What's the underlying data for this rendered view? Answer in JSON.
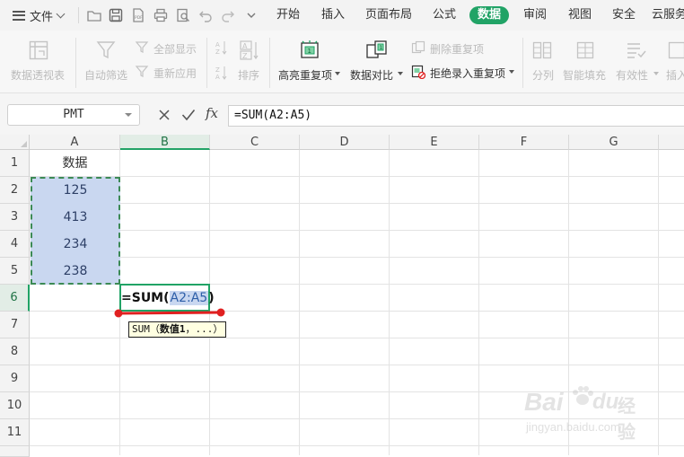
{
  "menu": {
    "file_label": "文件",
    "tabs": [
      {
        "label": "开始",
        "active": false
      },
      {
        "label": "插入",
        "active": false
      },
      {
        "label": "页面布局",
        "active": false
      },
      {
        "label": "公式",
        "active": false
      },
      {
        "label": "数据",
        "active": true
      },
      {
        "label": "审阅",
        "active": false
      },
      {
        "label": "视图",
        "active": false
      },
      {
        "label": "安全",
        "active": false
      },
      {
        "label": "云服务",
        "active": false
      }
    ]
  },
  "ribbon": {
    "pivot": "数据透视表",
    "autofilter": "自动筛选",
    "show_all": "全部显示",
    "reapply": "重新应用",
    "sort": "排序",
    "highlight_dup": "高亮重复项",
    "compare": "数据对比",
    "remove_dup": "删除重复项",
    "reject_dup": "拒绝录入重复项",
    "split": "分列",
    "flash_fill": "智能填充",
    "validity": "有效性",
    "insert": "插入"
  },
  "formula_bar": {
    "name_box": "PMT",
    "fx": "fx",
    "formula": "=SUM(A2:A5)"
  },
  "sheet": {
    "columns": [
      "A",
      "B",
      "C",
      "D",
      "E",
      "F",
      "G"
    ],
    "rows": [
      "1",
      "2",
      "3",
      "4",
      "5",
      "6",
      "7",
      "8",
      "9",
      "10",
      "11"
    ],
    "a1": "数据",
    "values": [
      "125",
      "413",
      "234",
      "238"
    ],
    "edit_prefix": "=SUM(",
    "edit_ref": "A2:A5",
    "edit_suffix": ")",
    "tooltip_fn": "SUM（",
    "tooltip_arg": "数值1",
    "tooltip_rest": "，...）"
  },
  "watermark": {
    "brand": "Bai",
    "brand2": "du",
    "cn": "经验",
    "url": "jingyan.baidu.com"
  },
  "colors": {
    "accent": "#21a366",
    "selection": "#c9d7f0",
    "annotation": "#e02020"
  }
}
